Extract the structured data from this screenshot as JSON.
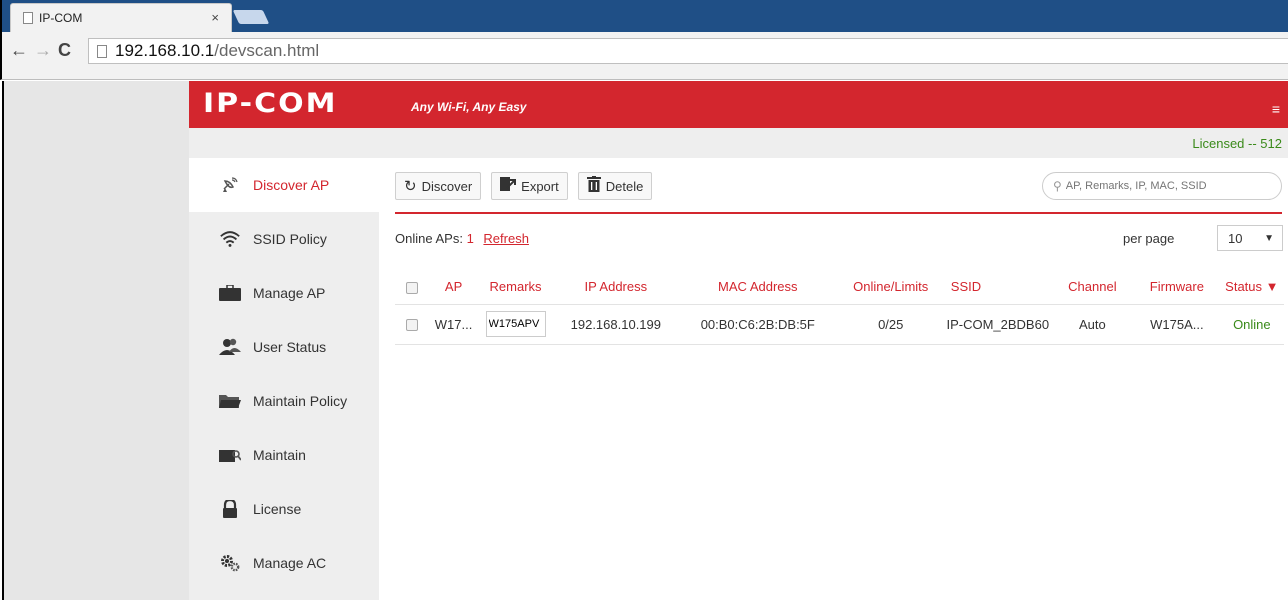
{
  "browser": {
    "tab_title": "IP-COM",
    "tab_close": "×",
    "url_host": "192.168.10.1",
    "url_path": "/devscan.html",
    "back": "←",
    "forward": "→",
    "reload": "C"
  },
  "header": {
    "logo": "IP-COM",
    "tagline": "Any Wi-Fi, Any Easy",
    "menu_icon": "≡",
    "license": "Licensed -- 512"
  },
  "sidebar": {
    "items": [
      {
        "label": "Discover AP",
        "icon": "satellite-icon",
        "active": true
      },
      {
        "label": "SSID Policy",
        "icon": "wifi-icon"
      },
      {
        "label": "Manage AP",
        "icon": "briefcase-icon"
      },
      {
        "label": "User Status",
        "icon": "users-icon"
      },
      {
        "label": "Maintain Policy",
        "icon": "folder-icon"
      },
      {
        "label": "Maintain",
        "icon": "maintain-icon"
      },
      {
        "label": "License",
        "icon": "lock-icon"
      },
      {
        "label": "Manage AC",
        "icon": "gears-icon"
      }
    ]
  },
  "toolbar": {
    "discover_label": "Discover",
    "export_label": "Export",
    "delete_label": "Detele",
    "search_placeholder": "AP, Remarks, IP, MAC, SSID"
  },
  "list": {
    "online_label": "Online APs:",
    "online_count": "1",
    "refresh_label": "Refresh",
    "per_page_label": "per page",
    "per_page_value": "10"
  },
  "table": {
    "headers": [
      "AP",
      "Remarks",
      "IP Address",
      "MAC Address",
      "Online/Limits",
      "SSID",
      "Channel",
      "Firmware",
      "Status ▼"
    ],
    "rows": [
      {
        "ap": "W17...",
        "remarks": "W175APV",
        "ip": "192.168.10.199",
        "mac": "00:B0:C6:2B:DB:5F",
        "online_limits": "0/25",
        "ssid": "IP-COM_2BDB60",
        "channel": "Auto",
        "firmware": "W175A...",
        "status": "Online"
      }
    ]
  },
  "colors": {
    "brand_red": "#d3262e",
    "status_green": "#3a8a1a"
  }
}
